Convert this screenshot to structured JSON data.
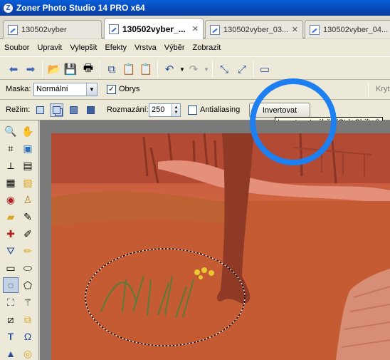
{
  "window": {
    "title": "Zoner Photo Studio 14 PRO x64",
    "logo_letter": "Z"
  },
  "tabs": [
    {
      "label": "130502vyber",
      "active": false
    },
    {
      "label": "130502vyber_...",
      "active": true
    },
    {
      "label": "130502vyber_03...",
      "active": false
    },
    {
      "label": "130502vyber_04...",
      "active": false
    }
  ],
  "menu": [
    "Soubor",
    "Upravit",
    "Vylepšit",
    "Efekty",
    "Vrstva",
    "Výběr",
    "Zobrazit"
  ],
  "toolbar": {
    "icons": [
      "back-arrow-icon",
      "forward-arrow-icon",
      "open-folder-icon",
      "save-icon",
      "print-icon",
      "copy-icon",
      "paste-icon",
      "paste-as-icon",
      "undo-icon",
      "redo-icon",
      "fit-icon",
      "crop-fit-icon",
      "ruler-icon"
    ]
  },
  "options1": {
    "mask_label": "Maska:",
    "mask_value": "Normální",
    "outline_label": "Obrys",
    "outline_checked": true,
    "right_cut_label": "Kryt"
  },
  "options2": {
    "mode_label": "Režim:",
    "blur_label": "Rozmazání:",
    "blur_value": "250",
    "antialias_label": "Antialiasing",
    "antialias_checked": false,
    "invert_button": "Invertovat",
    "tooltip": "Invertovat výběr (Ctrl+Shift+I)"
  },
  "tools": [
    "zoom-icon",
    "hand-icon",
    "crop-icon",
    "image-icon",
    "straighten-icon",
    "frame-icon",
    "levels-icon",
    "gradient-icon",
    "red-eye-icon",
    "stamp-icon",
    "eraser-icon",
    "brush-icon",
    "plus-brush-icon",
    "smudge-icon",
    "fill-icon",
    "pencil-icon",
    "rect-select-icon",
    "ellipse-select-icon",
    "lasso-icon",
    "polygon-lasso-icon",
    "magic-wand-icon",
    "wand-icon",
    "transform-icon",
    "warp-icon",
    "text-icon",
    "omega-icon",
    "sharpen-icon",
    "circle-icon"
  ],
  "colors": {
    "accent_ring": "#1e7ff0",
    "overlay": "#d4573a"
  }
}
